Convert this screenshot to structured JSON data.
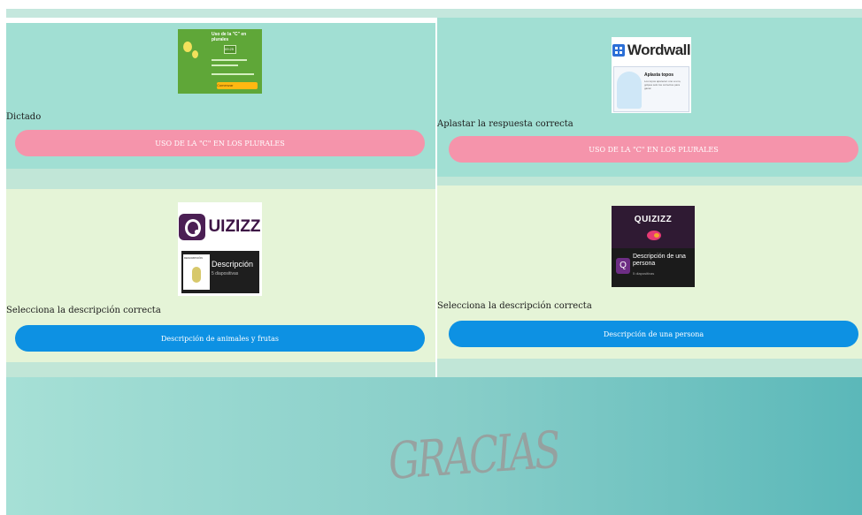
{
  "cards": [
    {
      "title": "Dictado",
      "button_label": "USO DE LA \"C\" EN LOS PLURALES",
      "thumb": {
        "heading": "Uso de la \"C\" en plurales",
        "clock": "09:25",
        "start_label": "Comenzar"
      }
    },
    {
      "title": "Aplastar la respuesta correcta",
      "button_label": "USO DE LA \"C\" EN LOS PLURALES",
      "thumb": {
        "brand": "Wordwall",
        "activity": "Aplasta topos",
        "desc": "Los topos aparecen uno a uno, golpea solo los correctos para ganar."
      }
    },
    {
      "title": "Selecciona la descripción correcta",
      "button_label": "Descripción de animales y frutas",
      "thumb": {
        "brand": "UIZIZZ",
        "box_label": "DESCRIPCIÓN",
        "quiz_title": "Descripción",
        "quiz_count": "5 diapositivas"
      }
    },
    {
      "title": "Selecciona la descripción correcta",
      "button_label": "Descripción de una persona",
      "thumb": {
        "brand": "QUIZIZZ",
        "quiz_title": "Descripción de una persona",
        "quiz_count": "5 diapositivas"
      }
    }
  ],
  "footer": {
    "signature": "GRACIAS"
  },
  "colors": {
    "teal_card": "#a1dfd3",
    "green_card": "#e5f4d7",
    "pink_button": "#f594ab",
    "blue_button": "#0d91e3"
  }
}
